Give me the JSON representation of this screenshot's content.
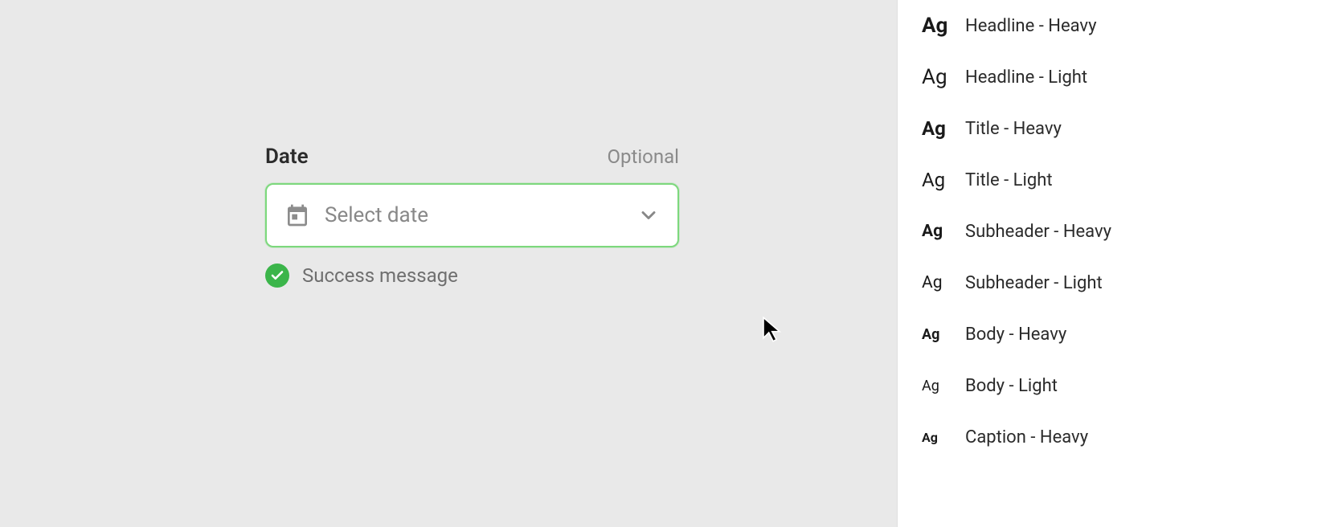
{
  "form": {
    "label": "Date",
    "optional": "Optional",
    "placeholder": "Select date",
    "help": "Success message"
  },
  "styles": [
    {
      "weight": "heavy",
      "size": "xl",
      "label": "Headline - Heavy"
    },
    {
      "weight": "light",
      "size": "xl",
      "label": "Headline - Light"
    },
    {
      "weight": "heavy",
      "size": "l",
      "label": "Title - Heavy"
    },
    {
      "weight": "light",
      "size": "l",
      "label": "Title - Light"
    },
    {
      "weight": "heavy",
      "size": "m",
      "label": "Subheader - Heavy"
    },
    {
      "weight": "light",
      "size": "m",
      "label": "Subheader - Light"
    },
    {
      "weight": "heavy",
      "size": "s",
      "label": "Body - Heavy"
    },
    {
      "weight": "light",
      "size": "s",
      "label": "Body - Light"
    },
    {
      "weight": "heavy",
      "size": "xs",
      "label": "Caption - Heavy"
    }
  ],
  "ag_glyph": "Ag"
}
